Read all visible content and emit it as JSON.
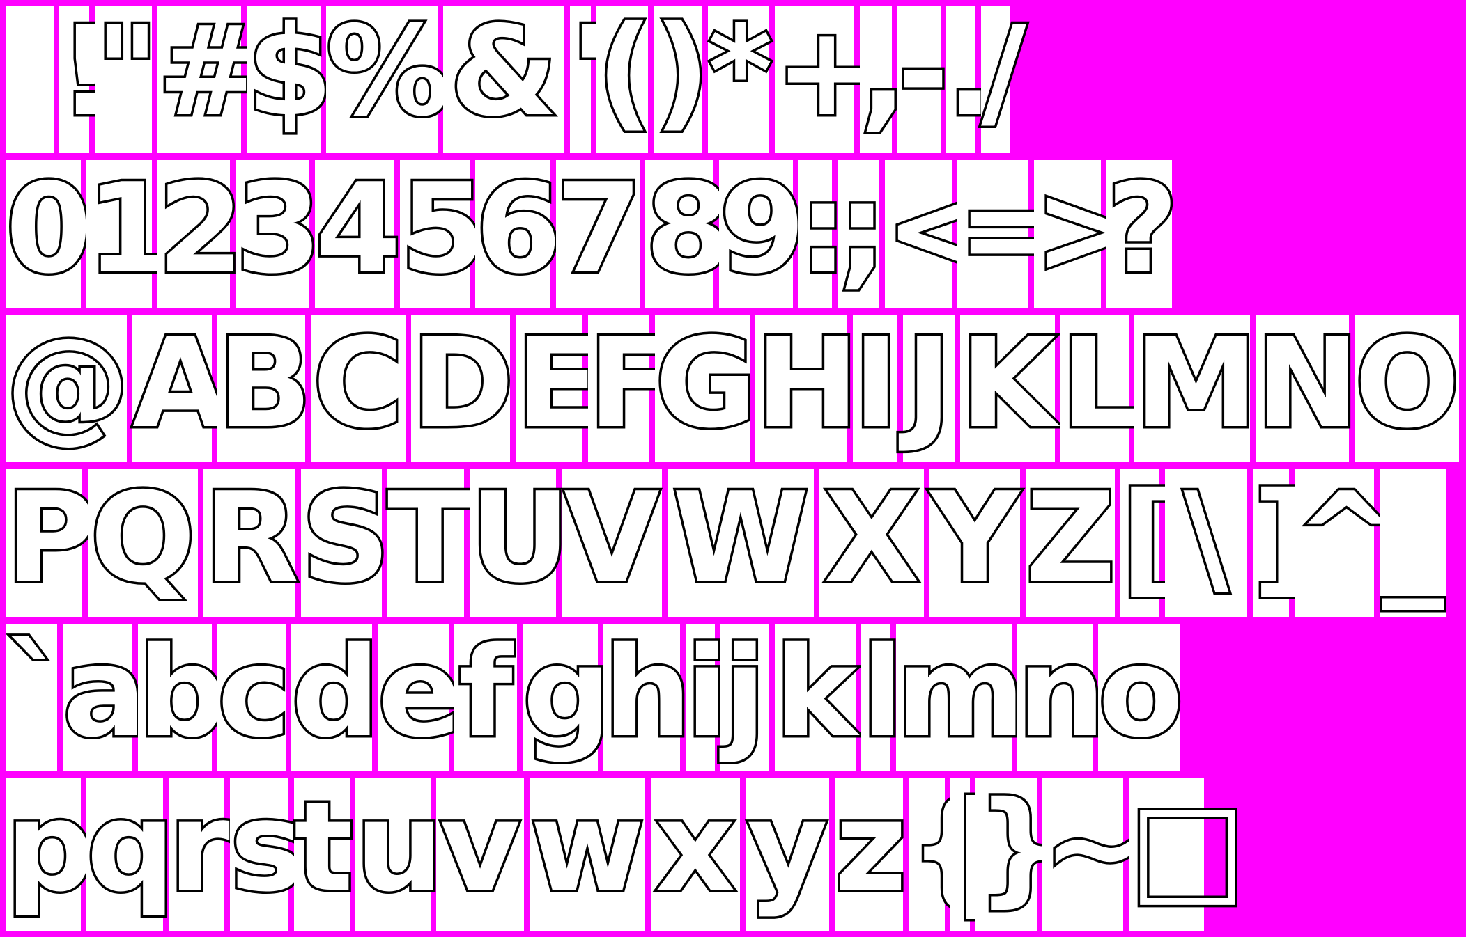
{
  "sheet": {
    "background_color": "#ff00ff",
    "cell_color": "#ffffff",
    "glyph_fill": "#ffffff",
    "glyph_outline": "#000000",
    "rows": [
      {
        "glyphs": [
          " ",
          "!",
          "\"",
          "#",
          "$",
          "%",
          "&",
          "'",
          "(",
          ")",
          "*",
          "+",
          ",",
          "-",
          ".",
          "/"
        ]
      },
      {
        "glyphs": [
          "0",
          "1",
          "2",
          "3",
          "4",
          "5",
          "6",
          "7",
          "8",
          "9",
          ":",
          ";",
          "<",
          "=",
          ">",
          "?"
        ]
      },
      {
        "glyphs": [
          "@",
          "A",
          "B",
          "C",
          "D",
          "E",
          "F",
          "G",
          "H",
          "I",
          "J",
          "K",
          "L",
          "M",
          "N",
          "O"
        ]
      },
      {
        "glyphs": [
          "P",
          "Q",
          "R",
          "S",
          "T",
          "U",
          "V",
          "W",
          "X",
          "Y",
          "Z",
          "[",
          "\\",
          "]",
          "^",
          "_"
        ]
      },
      {
        "glyphs": [
          "`",
          "a",
          "b",
          "c",
          "d",
          "e",
          "f",
          "g",
          "h",
          "i",
          "j",
          "k",
          "l",
          "m",
          "n",
          "o"
        ]
      },
      {
        "glyphs": [
          "p",
          "q",
          "r",
          "s",
          "t",
          "u",
          "v",
          "w",
          "x",
          "y",
          "z",
          "{",
          "|",
          "}",
          "~",
          "□"
        ]
      }
    ]
  }
}
